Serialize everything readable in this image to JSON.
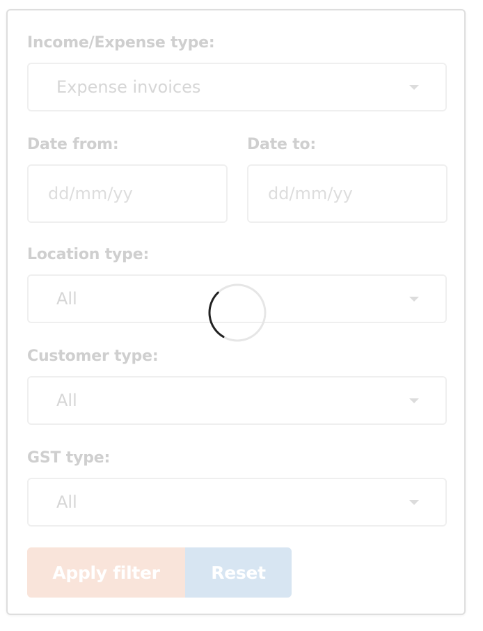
{
  "filters": {
    "income_expense": {
      "label": "Income/Expense type:",
      "value": "Expense invoices"
    },
    "date_from": {
      "label": "Date from:",
      "placeholder": "dd/mm/yy"
    },
    "date_to": {
      "label": "Date to:",
      "placeholder": "dd/mm/yy"
    },
    "location": {
      "label": "Location type:",
      "value": "All"
    },
    "customer": {
      "label": "Customer type:",
      "value": "All"
    },
    "gst": {
      "label": "GST type:",
      "value": "All"
    }
  },
  "actions": {
    "apply_label": "Apply filter",
    "reset_label": "Reset"
  },
  "colors": {
    "apply_bg": "#f9e4da",
    "reset_bg": "#d7e5f2",
    "spinner": "#222222"
  },
  "icons": {
    "dropdown": "chevron-down-icon",
    "loading": "spinner-icon"
  }
}
